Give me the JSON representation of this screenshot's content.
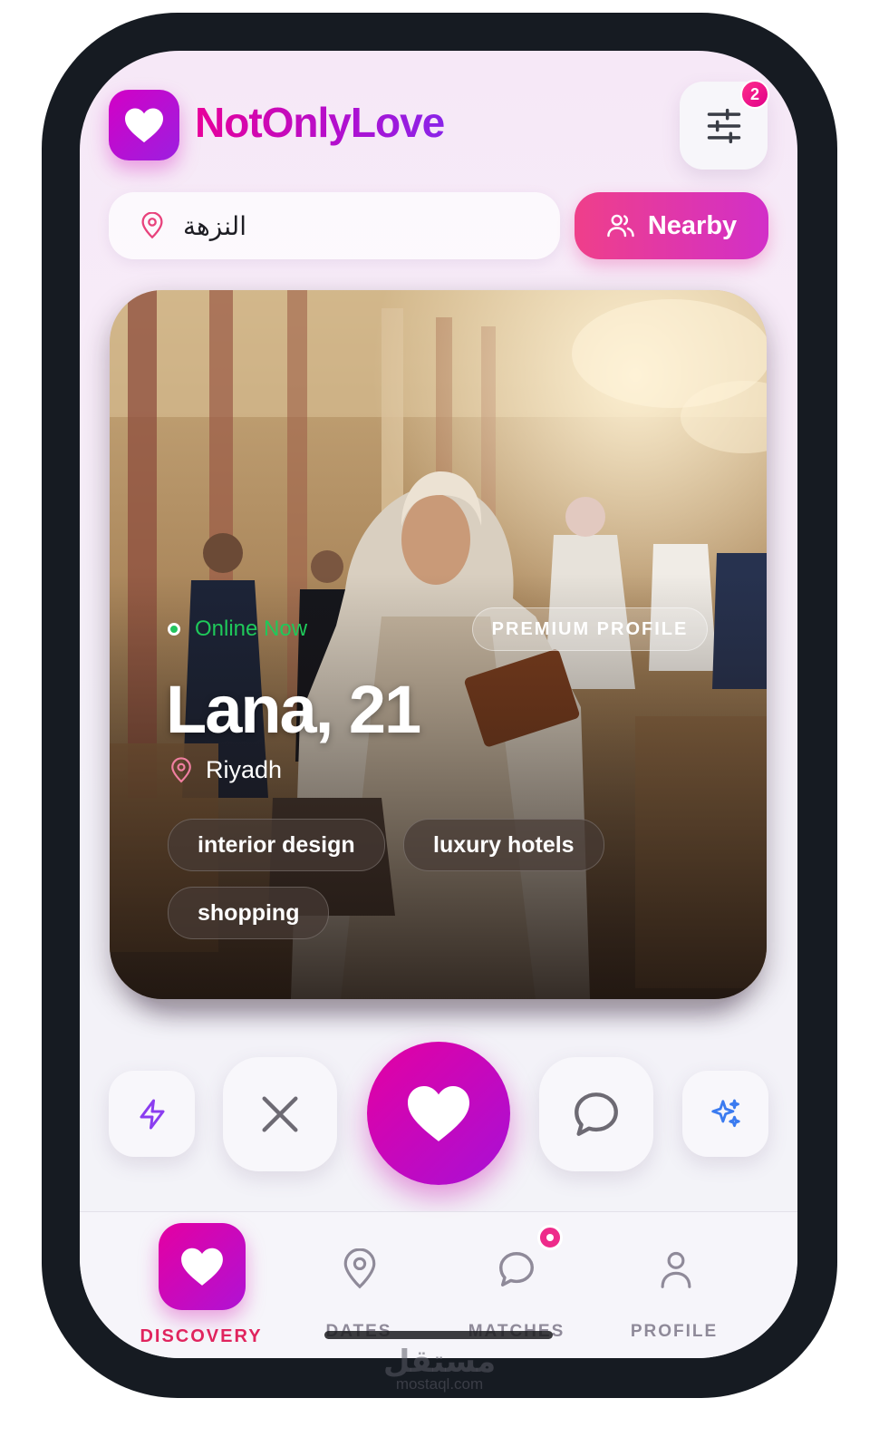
{
  "app": {
    "brand": "NotOnlyLove",
    "filter_badge_count": "2"
  },
  "search": {
    "location": "النزهة",
    "nearby_label": "Nearby"
  },
  "profile_card": {
    "status": "Online Now",
    "badge": "PREMIUM PROFILE",
    "name_age": "Lana, 21",
    "city": "Riyadh",
    "interests": [
      "interior design",
      "luxury hotels",
      "shopping"
    ]
  },
  "actions": {
    "boost": "lightning-icon",
    "pass": "close-icon",
    "like": "heart-icon",
    "message": "chat-icon",
    "super": "sparkles-icon"
  },
  "bottom_nav": {
    "items": [
      {
        "label": "DISCOVERY",
        "icon": "heart-icon",
        "active": true
      },
      {
        "label": "DATES",
        "icon": "map-pin-icon",
        "active": false
      },
      {
        "label": "MATCHES",
        "icon": "chat-icon",
        "active": false,
        "notification": true
      },
      {
        "label": "PROFILE",
        "icon": "user-icon",
        "active": false
      }
    ]
  },
  "watermark": {
    "arabic": "مستقل",
    "site": "mostaql.com"
  },
  "colors": {
    "brand_magenta": "#e400a2",
    "brand_purple": "#a810d6",
    "nearby_pink": "#ef3f8a",
    "online_green": "#22c55e",
    "active_nav_label": "#e0245e",
    "boost_purple": "#8b3df0",
    "super_blue": "#3b7bf0"
  }
}
